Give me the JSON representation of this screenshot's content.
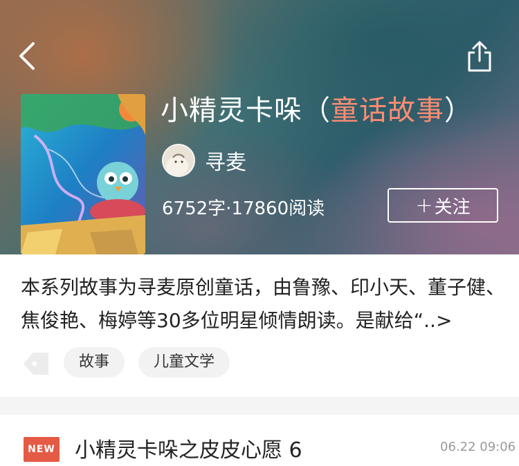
{
  "header": {
    "back_icon": "chevron-left-icon",
    "share_icon": "share-icon"
  },
  "album": {
    "title_main": "小精灵卡哚（",
    "title_accent": "童话故事",
    "title_end": "）",
    "author": "寻麦",
    "stats": "6752字·17860阅读",
    "follow_label": "关注",
    "description": "本系列故事为寻麦原创童话，由鲁豫、印小天、董子健、焦俊艳、梅婷等30多位明星倾情朗读。是献给“",
    "description_more": "..>"
  },
  "tags": [
    "故事",
    "儿童文学"
  ],
  "episodes": [
    {
      "badge": "NEW",
      "title": "小精灵卡哚之皮皮心愿 6",
      "time": "06.22 09:06"
    }
  ],
  "colors": {
    "accent": "#ff8c72",
    "badge": "#e55a45"
  }
}
